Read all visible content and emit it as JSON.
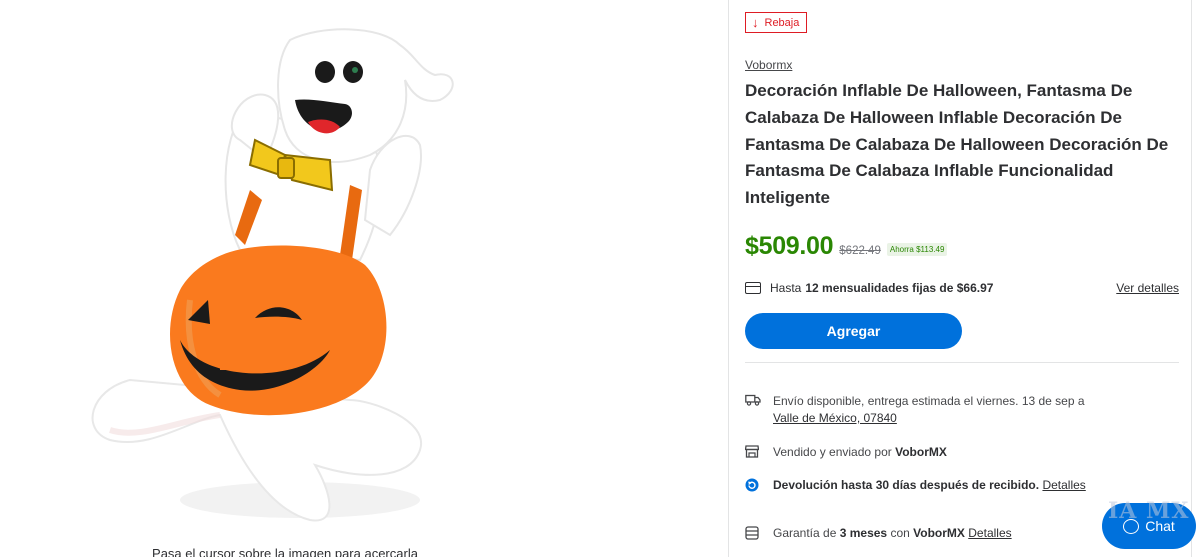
{
  "image": {
    "zoom_hint": "Pasa el cursor sobre la imagen para acercarla"
  },
  "product": {
    "badge": "Rebaja",
    "brand": "Vobormx",
    "title": "Decoración Inflable De Halloween, Fantasma De Calabaza De Halloween Inflable Decoración De Fantasma De Calabaza De Halloween Decoración De Fantasma De Calabaza Inflable Funcionalidad Inteligente",
    "price_current": "$509.00",
    "price_was": "$622.49",
    "savings": "Ahorra $113.49"
  },
  "installments": {
    "prefix": "Hasta",
    "bold": "12 mensualidades fijas de $66.97",
    "details_link": "Ver detalles"
  },
  "add_button": "Agregar",
  "shipping": {
    "text": "Envío disponible, entrega estimada el viernes. 13 de sep a",
    "location": "Valle de México, 07840"
  },
  "seller": {
    "prefix": "Vendido y enviado por",
    "name": "VoborMX"
  },
  "returns": {
    "text": "Devolución hasta 30 días después de recibido.",
    "link": "Detalles"
  },
  "warranty": {
    "prefix": "Garantía de",
    "duration": "3 meses",
    "middle": "con",
    "seller": "VoborMX",
    "link": "Detalles"
  },
  "chat": {
    "label": "Chat",
    "watermark": "IA MX"
  },
  "colors": {
    "accent": "#0071dc",
    "price_green": "#2a8703",
    "rollback_red": "#de1c24",
    "pumpkin_orange": "#fa7a1e"
  },
  "icons": [
    "down-arrow-icon",
    "credit-card-icon",
    "truck-icon",
    "store-icon",
    "return-icon",
    "warranty-icon",
    "chat-icon"
  ]
}
